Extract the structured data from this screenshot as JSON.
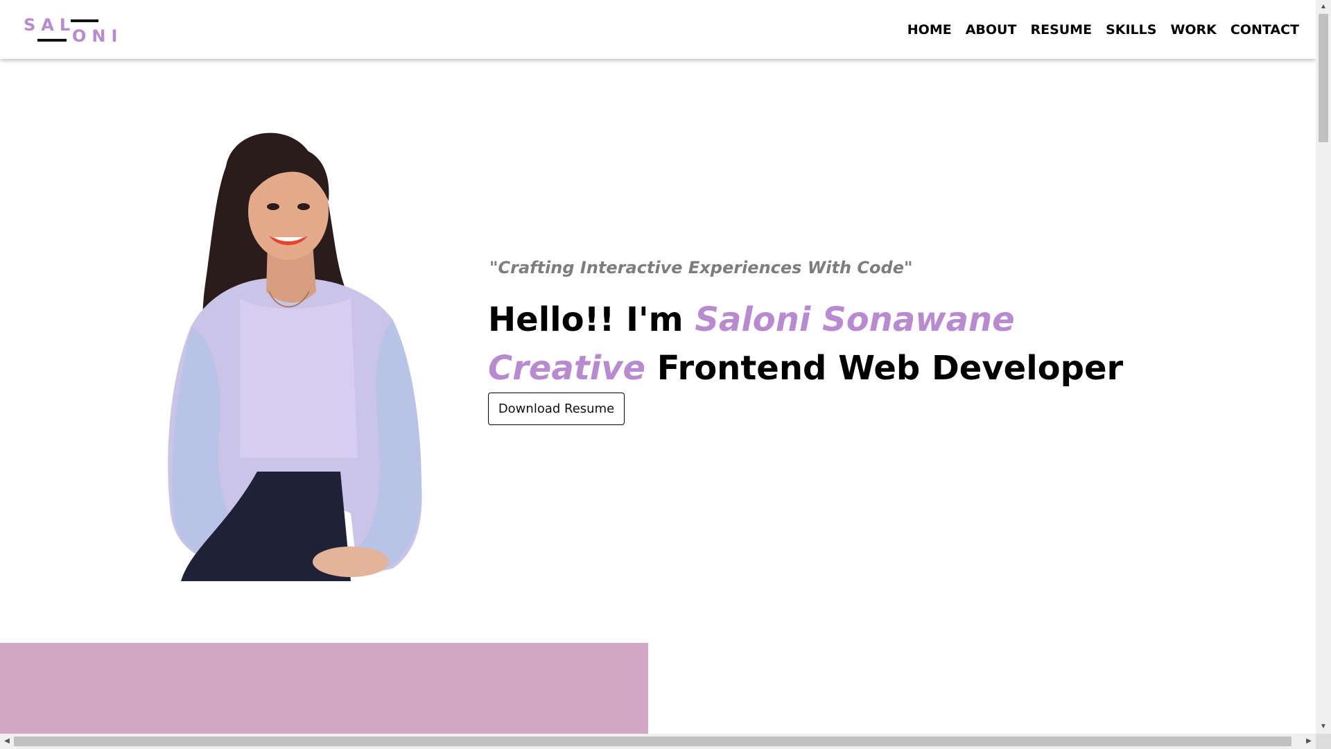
{
  "colors": {
    "accent": "#b88ad0",
    "pink_block": "#d4a8c5",
    "text": "#000000",
    "tagline": "#7d7d7d"
  },
  "logo": {
    "top_text": "SAL",
    "bottom_text": "ONI"
  },
  "nav": {
    "items": [
      {
        "label": "HOME"
      },
      {
        "label": "ABOUT"
      },
      {
        "label": "RESUME"
      },
      {
        "label": "SKILLS"
      },
      {
        "label": "WORK"
      },
      {
        "label": "CONTACT"
      }
    ]
  },
  "hero": {
    "tagline": "\"Crafting Interactive Experiences With Code\"",
    "greeting": "Hello!! I'm ",
    "name": "Saloni Sonawane",
    "creative": "Creative",
    "role": " Frontend Web Developer",
    "download_label": "Download Resume"
  },
  "icons": {
    "photo": "person-portrait-icon",
    "scroll_up": "chevron-up-icon",
    "scroll_down": "chevron-down-icon",
    "scroll_left": "chevron-left-icon",
    "scroll_right": "chevron-right-icon"
  }
}
